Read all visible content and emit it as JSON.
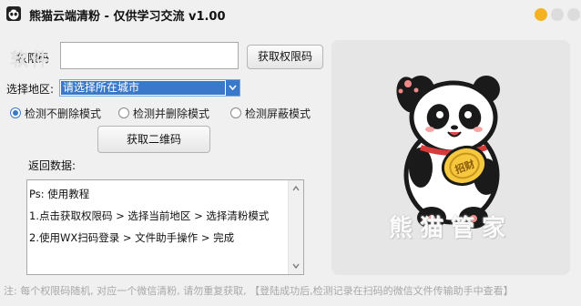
{
  "window": {
    "title": "熊猫云端清粉 - 仅供学习交流 v1.00",
    "colors": {
      "minimize": "#f5b324",
      "inactive": "#dcdcdc",
      "accent": "#3a79c9"
    }
  },
  "form": {
    "auth_label": "权限码",
    "auth_value": "",
    "auth_watermark": "软件",
    "auth_button": "获取权限码",
    "region_label": "选择地区:",
    "region_value": "请选择所在城市",
    "modes": [
      {
        "label": "检测不删除模式",
        "checked": true
      },
      {
        "label": "检测并删除模式",
        "checked": false
      },
      {
        "label": "检测屏蔽模式",
        "checked": false
      }
    ],
    "qr_button": "获取二维码",
    "return_label": "返回数据:"
  },
  "log": {
    "lines": [
      "Ps: 使用教程",
      "1.点击获取权限码 > 选择当前地区 > 选择清粉模式",
      "2.使用WX扫码登录 > 文件助手操作 > 完成"
    ]
  },
  "panel": {
    "brand": "熊猫管家",
    "coin_text": "招财"
  },
  "footer": "注: 每个权限码随机, 对应一个微信清粉, 请勿重复获取, 【登陆成功后,检测记录在扫码的微信文件传输助手中查看】",
  "icons": [
    "panda-app-icon",
    "minimize-icon",
    "maximize-icon",
    "close-icon",
    "chevron-down-icon",
    "scroll-up-icon",
    "scroll-down-icon",
    "panda-mascot"
  ]
}
